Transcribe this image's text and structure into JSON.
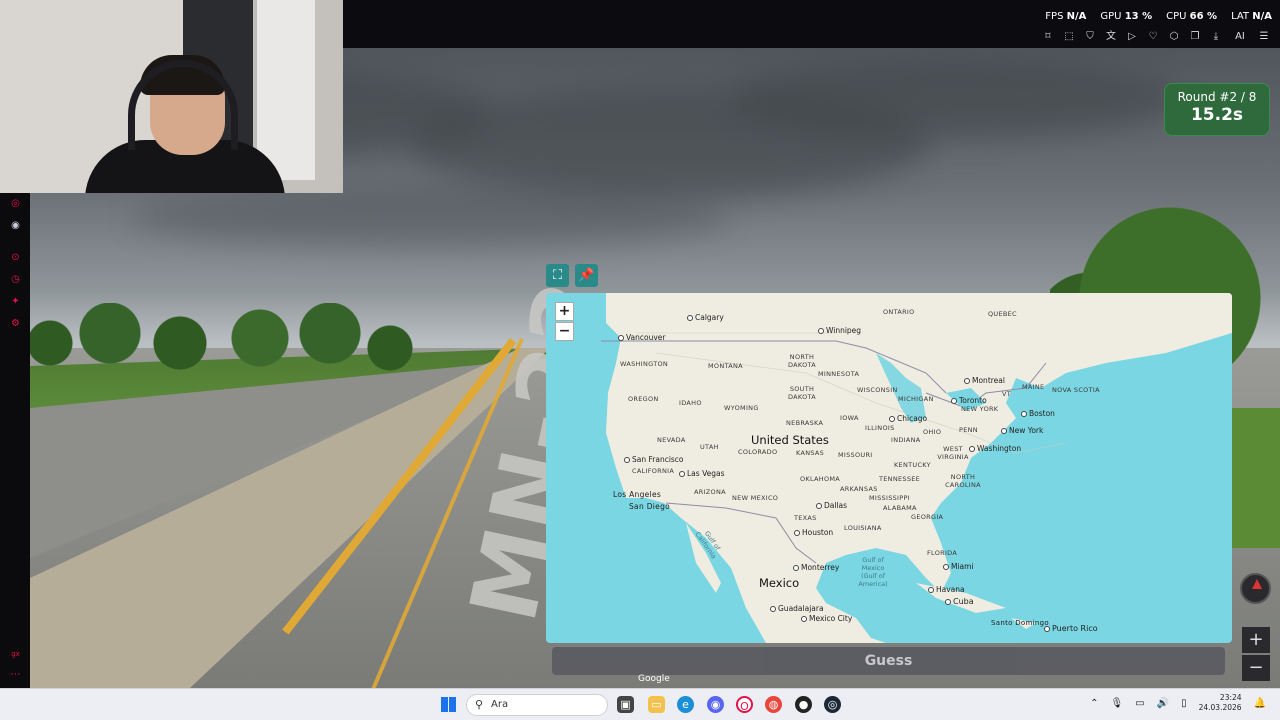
{
  "topbar": {
    "stats": [
      {
        "label": "FPS",
        "value": "N/A"
      },
      {
        "label": "GPU",
        "value": "13 %"
      },
      {
        "label": "CPU",
        "value": "66 %"
      },
      {
        "label": "LAT",
        "value": "N/A"
      }
    ],
    "toolbar_icons": [
      "bookmark-icon",
      "crop-icon",
      "shield-icon",
      "translate-icon",
      "play-icon",
      "heart-icon",
      "extensions-icon",
      "copy-icon",
      "download-icon",
      "ai-icon",
      "menu-icon"
    ],
    "ai_label": "AI"
  },
  "round": {
    "label": "Round #2 / 8",
    "time": "15.2s"
  },
  "scene": {
    "road_marking": "MN-22"
  },
  "map": {
    "zoom_in": "+",
    "zoom_out": "−",
    "countries": [
      {
        "id": "us",
        "text": "United States"
      },
      {
        "id": "mx",
        "text": "Mexico"
      },
      {
        "id": "cu",
        "text": "Cuba"
      },
      {
        "id": "pr",
        "text": "Puerto Rico"
      }
    ],
    "cities": [
      {
        "id": "calgary",
        "text": "Calgary"
      },
      {
        "id": "winnipeg",
        "text": "Winnipeg"
      },
      {
        "id": "vancouver",
        "text": "Vancouver"
      },
      {
        "id": "montreal",
        "text": "Montreal"
      },
      {
        "id": "toronto",
        "text": "Toronto"
      },
      {
        "id": "boston",
        "text": "Boston"
      },
      {
        "id": "newyork",
        "text": "New York"
      },
      {
        "id": "chicago",
        "text": "Chicago"
      },
      {
        "id": "washington",
        "text": "Washington"
      },
      {
        "id": "sanfrancisco",
        "text": "San Francisco"
      },
      {
        "id": "lasvegas",
        "text": "Las Vegas"
      },
      {
        "id": "losangeles",
        "text": "Los Angeles"
      },
      {
        "id": "sandiego",
        "text": "San Diego"
      },
      {
        "id": "dallas",
        "text": "Dallas"
      },
      {
        "id": "houston",
        "text": "Houston"
      },
      {
        "id": "monterrey",
        "text": "Monterrey"
      },
      {
        "id": "miami",
        "text": "Miami"
      },
      {
        "id": "havana",
        "text": "Havana"
      },
      {
        "id": "guadalajara",
        "text": "Guadalajara"
      },
      {
        "id": "mexicocity",
        "text": "Mexico City"
      },
      {
        "id": "santodomingo",
        "text": "Santo Domingo"
      }
    ],
    "regions": [
      {
        "id": "ontario",
        "text": "ONTARIO"
      },
      {
        "id": "quebec",
        "text": "QUEBEC"
      },
      {
        "id": "washington_st",
        "text": "WASHINGTON"
      },
      {
        "id": "montana",
        "text": "MONTANA"
      },
      {
        "id": "northdakota",
        "text": "NORTH DAKOTA"
      },
      {
        "id": "minnesota",
        "text": "MINNESOTA"
      },
      {
        "id": "oregon",
        "text": "OREGON"
      },
      {
        "id": "idaho",
        "text": "IDAHO"
      },
      {
        "id": "wyoming",
        "text": "WYOMING"
      },
      {
        "id": "southdakota",
        "text": "SOUTH DAKOTA"
      },
      {
        "id": "wisconsin",
        "text": "WISCONSIN"
      },
      {
        "id": "michigan",
        "text": "MICHIGAN"
      },
      {
        "id": "newyork_st",
        "text": "NEW YORK"
      },
      {
        "id": "maine",
        "text": "MAINE"
      },
      {
        "id": "vt",
        "text": "VT"
      },
      {
        "id": "novascotia",
        "text": "NOVA SCOTIA"
      },
      {
        "id": "nevada",
        "text": "NEVADA"
      },
      {
        "id": "utah",
        "text": "UTAH"
      },
      {
        "id": "colorado",
        "text": "COLORADO"
      },
      {
        "id": "nebraska",
        "text": "NEBRASKA"
      },
      {
        "id": "iowa",
        "text": "IOWA"
      },
      {
        "id": "illinois",
        "text": "ILLINOIS"
      },
      {
        "id": "indiana",
        "text": "INDIANA"
      },
      {
        "id": "ohio",
        "text": "OHIO"
      },
      {
        "id": "penn",
        "text": "PENN"
      },
      {
        "id": "california",
        "text": "CALIFORNIA"
      },
      {
        "id": "kansas",
        "text": "KANSAS"
      },
      {
        "id": "missouri",
        "text": "MISSOURI"
      },
      {
        "id": "kentucky",
        "text": "KENTUCKY"
      },
      {
        "id": "westvirginia",
        "text": "WEST VIRGINIA"
      },
      {
        "id": "arizona",
        "text": "ARIZONA"
      },
      {
        "id": "newmexico",
        "text": "NEW MEXICO"
      },
      {
        "id": "oklahoma",
        "text": "OKLAHOMA"
      },
      {
        "id": "arkansas",
        "text": "ARKANSAS"
      },
      {
        "id": "tennessee",
        "text": "TENNESSEE"
      },
      {
        "id": "northcarolina",
        "text": "NORTH CAROLINA"
      },
      {
        "id": "mississippi",
        "text": "MISSISSIPPI"
      },
      {
        "id": "alabama",
        "text": "ALABAMA"
      },
      {
        "id": "georgia",
        "text": "GEORGIA"
      },
      {
        "id": "texas",
        "text": "TEXAS"
      },
      {
        "id": "louisiana",
        "text": "LOUISIANA"
      },
      {
        "id": "florida",
        "text": "FLORIDA"
      }
    ],
    "seas": [
      {
        "id": "gulfcalifornia",
        "text": "Gulf of California"
      },
      {
        "id": "gulfmexico",
        "text": "Gulf of Mexico (Gulf of America)"
      }
    ],
    "attribution": "Google"
  },
  "guess_button": "Guess",
  "taskbar": {
    "search_placeholder": "Ara",
    "time": "23:24",
    "date": "24.03.2026"
  }
}
